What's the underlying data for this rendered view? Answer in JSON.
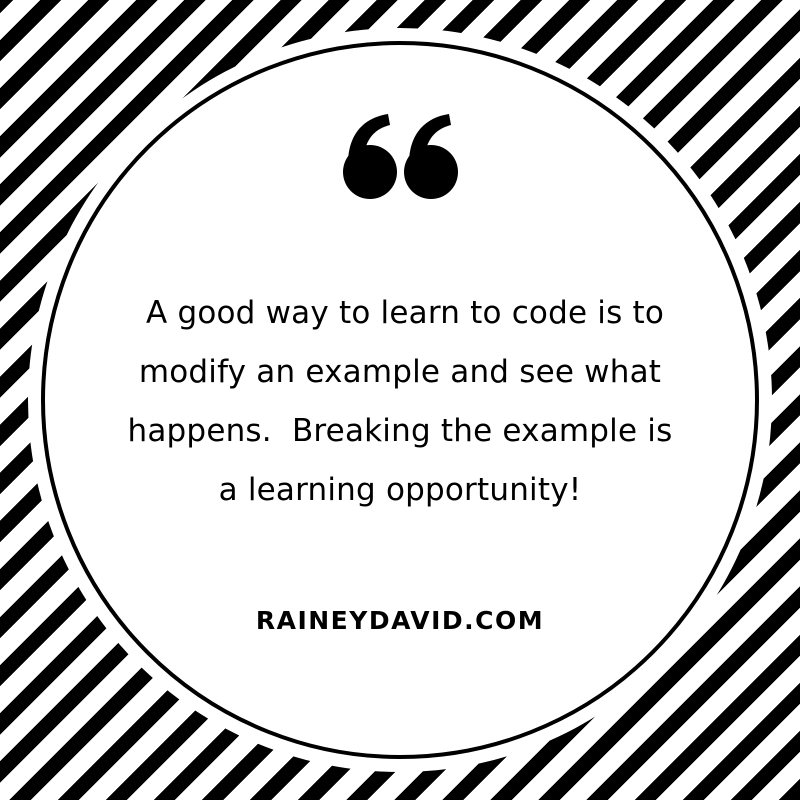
{
  "quote": {
    "icon": "quotation-mark-icon",
    "lines": [
      " A good way to learn to code is to",
      "modify an example and see what",
      "happens.  Breaking the example is",
      "a learning opportunity!"
    ]
  },
  "attribution": "RAINEYDAVID.COM",
  "colors": {
    "stripe": "#000000",
    "background": "#ffffff",
    "text": "#000000"
  }
}
